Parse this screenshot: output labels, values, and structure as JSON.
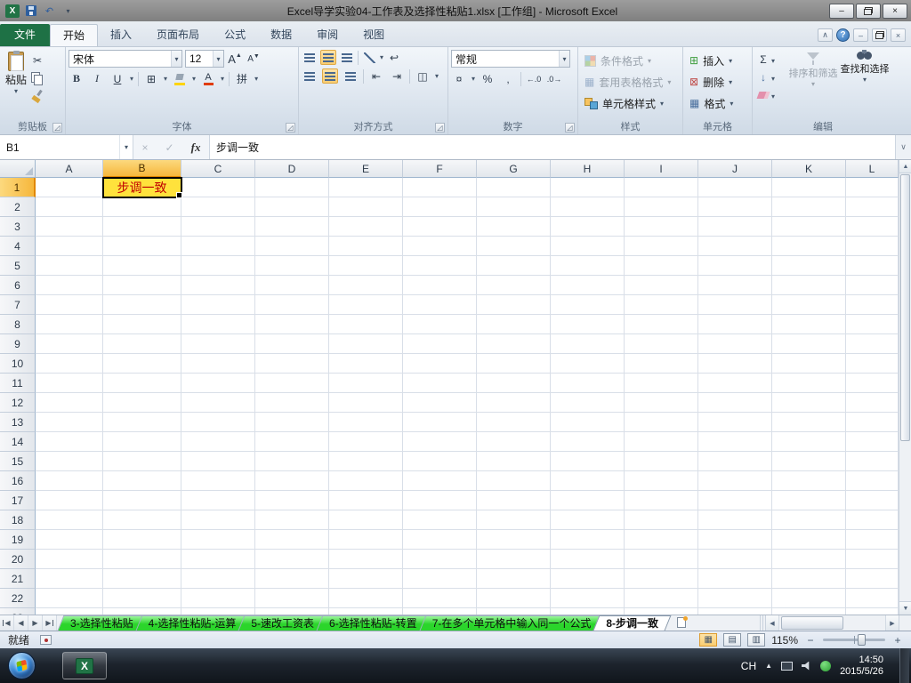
{
  "window": {
    "title": "Excel导学实验04-工作表及选择性粘贴1.xlsx [工作组] - Microsoft Excel"
  },
  "ribbon": {
    "tabs": [
      "文件",
      "开始",
      "插入",
      "页面布局",
      "公式",
      "数据",
      "审阅",
      "视图"
    ],
    "active_tab": "开始",
    "clipboard": {
      "paste": "粘贴",
      "label": "剪贴板"
    },
    "font": {
      "name": "宋体",
      "size": "12",
      "bold": "B",
      "italic": "I",
      "underline": "U",
      "label": "字体"
    },
    "alignment": {
      "label": "对齐方式"
    },
    "number": {
      "format": "常规",
      "label": "数字"
    },
    "styles": {
      "items": [
        "条件格式",
        "套用表格格式",
        "单元格样式"
      ],
      "label": "样式"
    },
    "cells": {
      "items": [
        "插入",
        "删除",
        "格式"
      ],
      "label": "单元格"
    },
    "editing": {
      "sort": "排序和筛选",
      "find": "查找和选择",
      "label": "编辑"
    }
  },
  "formula_bar": {
    "cell_ref": "B1",
    "fx": "fx",
    "content": "步调一致"
  },
  "grid": {
    "columns": [
      "A",
      "B",
      "C",
      "D",
      "E",
      "F",
      "G",
      "H",
      "I",
      "J",
      "K",
      "L"
    ],
    "row_count": 23,
    "active_cell": {
      "col": "B",
      "row": 1,
      "text": "步调一致"
    }
  },
  "sheet_tabs": {
    "tabs": [
      {
        "label": "3-选择性粘贴",
        "grouped": true,
        "active": false
      },
      {
        "label": "4-选择性粘贴-运算",
        "grouped": true,
        "active": false
      },
      {
        "label": "5-速改工资表",
        "grouped": true,
        "active": false
      },
      {
        "label": "6-选择性粘贴-转置",
        "grouped": true,
        "active": false
      },
      {
        "label": "7-在多个单元格中输入同一个公式",
        "grouped": true,
        "active": false
      },
      {
        "label": "8-步调一致",
        "grouped": true,
        "active": true
      }
    ]
  },
  "status_bar": {
    "mode": "就绪",
    "zoom": "115%"
  },
  "taskbar": {
    "language": "CH",
    "time": "14:50",
    "date": "2015/5/26"
  },
  "colors": {
    "file_tab_green": "#1e7145",
    "grouped_tab_green": "#2bd52b",
    "active_cell_fill": "#ffe23c",
    "active_cell_text": "#c00000",
    "selected_header": "#f6b73c"
  },
  "icons": {
    "excel_x": "X",
    "undo": "↶",
    "qat_more": "▾",
    "dropdown": "▾",
    "win_min": "–",
    "win_close": "×",
    "collapse": "∧",
    "help": "?",
    "wb_min": "–",
    "wb_close": "×",
    "cut": "✂",
    "grow": "A",
    "shrink": "A",
    "borders": "⊞",
    "font_color": "A",
    "phonetic": "拼",
    "wrap": "↩",
    "merge": "◫",
    "indent_dec": "⇤",
    "indent_inc": "⇥",
    "currency": "¤",
    "percent": "%",
    "comma": ",",
    "inc_decimal": "←.0",
    "dec_decimal": ".0→",
    "sigma": "Σ",
    "fill_down": "↓",
    "cancel": "×",
    "enter": "✓",
    "expand": "∨",
    "vs_up": "▲",
    "vs_down": "▼",
    "nav_prev": "◀",
    "nav_next": "▶",
    "hs_left": "◀",
    "hs_right": "▶",
    "view_normal": "▦",
    "view_layout": "▤",
    "view_break": "▥",
    "table_icon": "▦",
    "insert_cells": "⊞",
    "delete_cells": "⊠",
    "format_cells": "▦",
    "zoom_out": "−",
    "zoom_in": "+",
    "tray_arrow": "▲",
    "save": "css-floppy",
    "paste": "css-clipboard",
    "copy": "css-pages",
    "format_painter": "css-brush",
    "fill_color": "css-bucket",
    "conditional_formatting": "css-quad",
    "cell_styles": "css-palette",
    "eraser": "css-eraser",
    "sort_filter": "css-funnel",
    "find_select": "css-binoculars",
    "insert_sheet": "css-page",
    "restore_window": "css-two-squares",
    "start_orb": "css-windows-orb",
    "speaker": "css-speaker",
    "monitor": "css-monitor",
    "security": "css-green-circle"
  }
}
